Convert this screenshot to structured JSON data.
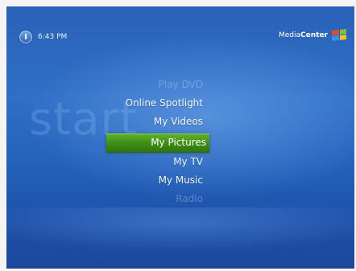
{
  "status": {
    "time": "6:43 PM"
  },
  "brand": {
    "prefix": "Media",
    "suffix": "Center"
  },
  "watermark": "start",
  "menu": {
    "items": [
      {
        "label": "Play DVD",
        "state": "faded"
      },
      {
        "label": "Online Spotlight",
        "state": "normal"
      },
      {
        "label": "My Videos",
        "state": "normal"
      },
      {
        "label": "My Pictures",
        "state": "selected"
      },
      {
        "label": "My TV",
        "state": "normal"
      },
      {
        "label": "My Music",
        "state": "normal"
      },
      {
        "label": "Radio",
        "state": "faded"
      }
    ]
  },
  "colors": {
    "background": "#2a62b8",
    "selection": "#3f8e17",
    "text": "#f2f6fc"
  }
}
